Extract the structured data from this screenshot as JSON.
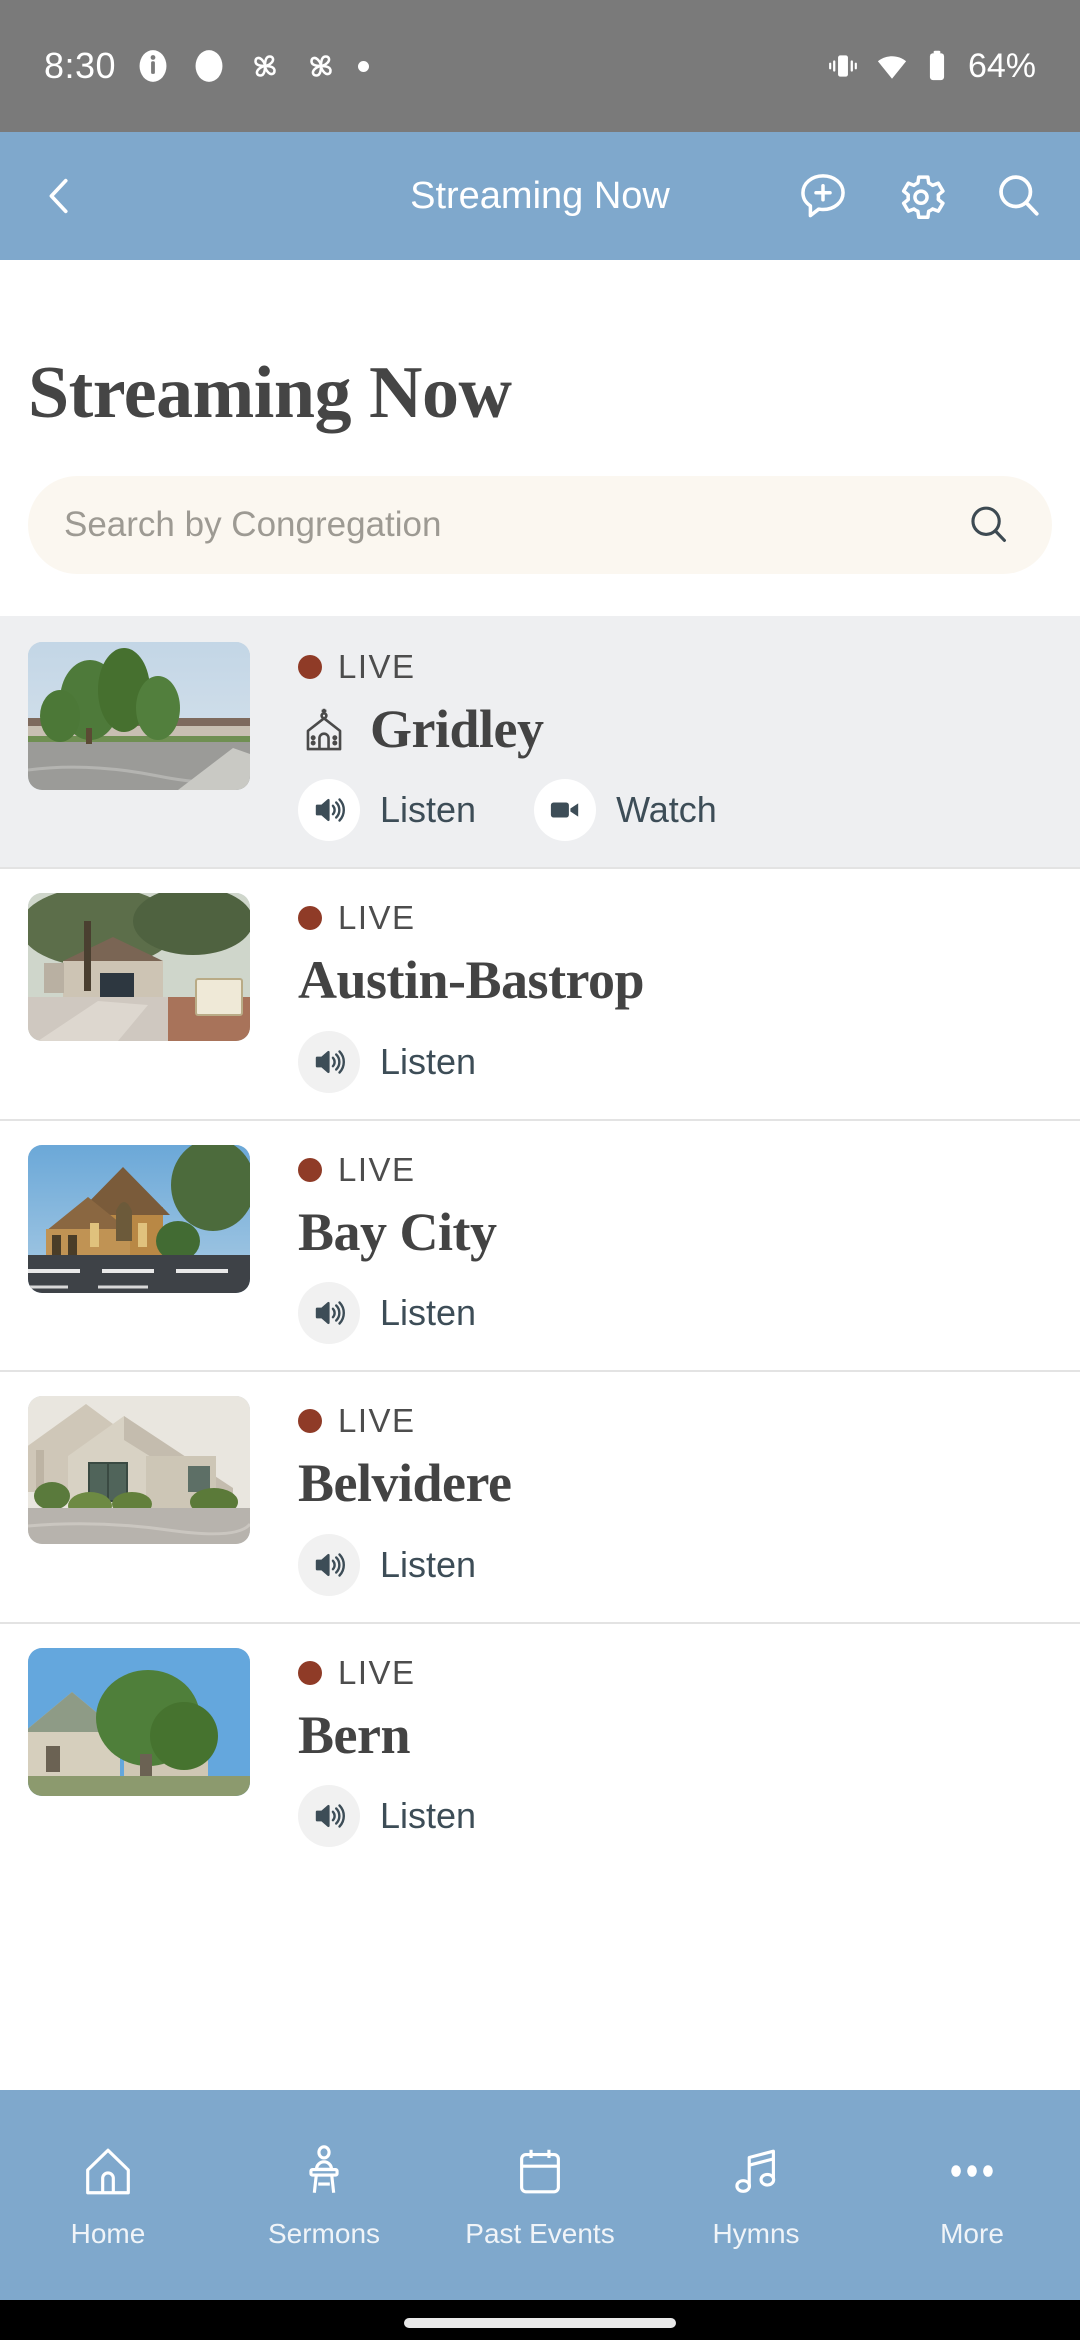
{
  "status_bar": {
    "time": "8:30",
    "battery_percent": "64%",
    "left_icons": [
      "info-icon",
      "circle-icon",
      "pinwheel-icon",
      "pinwheel-icon",
      "dot-icon"
    ],
    "right_icons": [
      "vibrate-icon",
      "wifi-icon",
      "battery-icon"
    ]
  },
  "nav_bar": {
    "title": "Streaming Now",
    "back_icon": "chevron-left-icon",
    "actions": [
      "message-add-icon",
      "gear-icon",
      "search-icon"
    ],
    "background": "#7fa8cc"
  },
  "page": {
    "title": "Streaming Now"
  },
  "search": {
    "placeholder": "Search by Congregation",
    "value": "",
    "icon": "search-icon",
    "background": "#fbf7f0"
  },
  "colors": {
    "accent_blue": "#7fa8cc",
    "live_dot": "#8f3b27",
    "action_text": "#3d4d57",
    "title_text": "#434343",
    "row_highlight": "#eeeff1"
  },
  "list": {
    "items": [
      {
        "status": "LIVE",
        "name": "Gridley",
        "has_church_icon": true,
        "highlighted": true,
        "actions": [
          {
            "label": "Listen",
            "icon": "speaker-icon"
          },
          {
            "label": "Watch",
            "icon": "video-camera-icon"
          }
        ]
      },
      {
        "status": "LIVE",
        "name": "Austin-Bastrop",
        "has_church_icon": false,
        "highlighted": false,
        "actions": [
          {
            "label": "Listen",
            "icon": "speaker-icon"
          }
        ]
      },
      {
        "status": "LIVE",
        "name": "Bay City",
        "has_church_icon": false,
        "highlighted": false,
        "actions": [
          {
            "label": "Listen",
            "icon": "speaker-icon"
          }
        ]
      },
      {
        "status": "LIVE",
        "name": "Belvidere",
        "has_church_icon": false,
        "highlighted": false,
        "actions": [
          {
            "label": "Listen",
            "icon": "speaker-icon"
          }
        ]
      },
      {
        "status": "LIVE",
        "name": "Bern",
        "has_church_icon": false,
        "highlighted": false,
        "actions": [
          {
            "label": "Listen",
            "icon": "speaker-icon"
          }
        ]
      }
    ]
  },
  "bottom_nav": {
    "tabs": [
      {
        "label": "Home",
        "icon": "house-icon"
      },
      {
        "label": "Sermons",
        "icon": "pulpit-icon"
      },
      {
        "label": "Past Events",
        "icon": "calendar-icon"
      },
      {
        "label": "Hymns",
        "icon": "music-note-icon"
      },
      {
        "label": "More",
        "icon": "ellipsis-icon"
      }
    ]
  }
}
